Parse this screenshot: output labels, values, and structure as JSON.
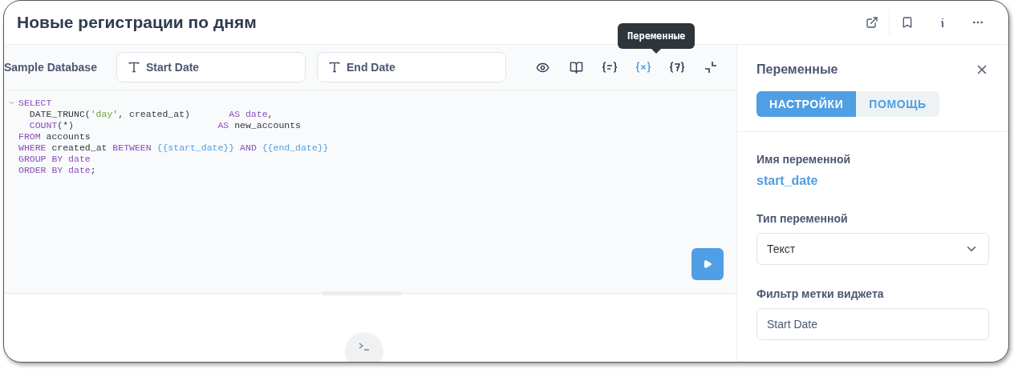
{
  "title": "Новые регистрации по дням",
  "header_actions": [
    {
      "kind": "share"
    },
    {
      "kind": "bookmark"
    },
    {
      "kind": "info"
    },
    {
      "kind": "more"
    }
  ],
  "database": "Sample Database",
  "filters": [
    {
      "label": "Start Date"
    },
    {
      "label": "End Date"
    }
  ],
  "tools": [
    {
      "kind": "preview",
      "selected": false
    },
    {
      "kind": "reference",
      "selected": false
    },
    {
      "kind": "snippets",
      "selected": false
    },
    {
      "kind": "variables",
      "selected": true
    },
    {
      "kind": "functions",
      "selected": false
    },
    {
      "kind": "collapse",
      "selected": false
    }
  ],
  "tooltip": "Переменные",
  "code": [
    [
      {
        "kind": "keyword",
        "text": "SELECT"
      }
    ],
    [
      {
        "kind": "plain",
        "text": "  DATE_TRUNC("
      },
      {
        "kind": "string",
        "text": "'day'"
      },
      {
        "kind": "plain",
        "text": ", created_at)       "
      },
      {
        "kind": "keyword",
        "text": "AS date"
      },
      {
        "kind": "plain",
        "text": ","
      }
    ],
    [
      {
        "kind": "keyword",
        "text": "  COUNT"
      },
      {
        "kind": "plain",
        "text": "(*)                          "
      },
      {
        "kind": "keyword",
        "text": "AS"
      },
      {
        "kind": "plain",
        "text": " new_accounts"
      }
    ],
    [
      {
        "kind": "keyword",
        "text": "FROM"
      },
      {
        "kind": "plain",
        "text": " accounts"
      }
    ],
    [
      {
        "kind": "keyword",
        "text": "WHERE"
      },
      {
        "kind": "plain",
        "text": " created_at "
      },
      {
        "kind": "keyword",
        "text": "BETWEEN"
      },
      {
        "kind": "variable",
        "text": " {{start_date}}"
      },
      {
        "kind": "keyword",
        "text": " AND"
      },
      {
        "kind": "variable",
        "text": " {{end_date}}"
      }
    ],
    [
      {
        "kind": "keyword",
        "text": "GROUP BY date"
      }
    ],
    [
      {
        "kind": "keyword",
        "text": "ORDER BY date"
      },
      {
        "kind": "plain",
        "text": ";"
      }
    ]
  ],
  "panel": {
    "title": "Переменные",
    "tabs": [
      {
        "label": "НАСТРОЙКИ",
        "selected": true
      },
      {
        "label": "ПОМОЩЬ",
        "selected": false
      }
    ],
    "variable_name_label": "Имя переменной",
    "variable_name": "start_date",
    "variable_type_label": "Тип переменной",
    "variable_type": "Текст",
    "widget_label_label": "Фильтр метки виджета",
    "widget_label": "Start Date"
  }
}
